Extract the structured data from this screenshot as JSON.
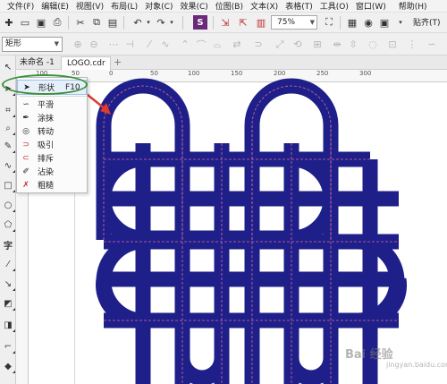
{
  "menu": {
    "items": [
      "文件(F)",
      "编辑(E)",
      "视图(V)",
      "布局(L)",
      "对象(C)",
      "效果(C)",
      "位图(B)",
      "文本(X)",
      "表格(T)",
      "工具(O)",
      "窗口(W)",
      "帮助(H)"
    ]
  },
  "toolbar": {
    "zoom": "75%",
    "snap_label": "贴齐(T)"
  },
  "property_bar": {
    "shape_select": "矩形"
  },
  "tabs": [
    {
      "label": "未命名 -1"
    },
    {
      "label": "LOGO.cdr"
    }
  ],
  "ruler": {
    "h_numbers": [
      "100",
      "50",
      "0",
      "50",
      "100",
      "150",
      "200",
      "250",
      "300"
    ]
  },
  "shape_flyout": {
    "selected": {
      "label": "形状",
      "shortcut": "F10"
    },
    "items": [
      "平滑",
      "涂抹",
      "转动",
      "吸引",
      "排斥",
      "沾染",
      "粗糙"
    ]
  },
  "colors": {
    "logo_fill": "#1f1f8a",
    "guide_dash": "#d86a9a",
    "annotation_red": "#e03b2e",
    "annotation_green": "#3a8f3a",
    "selection_blue": "#e6f0fb"
  },
  "watermark": {
    "text": "Bai 经验",
    "sub": "jingyan.baidu.com"
  }
}
